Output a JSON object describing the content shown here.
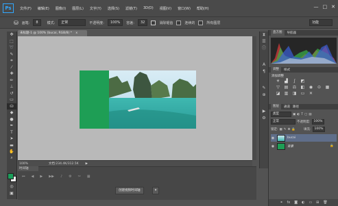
{
  "app": {
    "logo": "Ps"
  },
  "menu": [
    "文件(F)",
    "编辑(E)",
    "图像(I)",
    "图层(L)",
    "文字(Y)",
    "选择(S)",
    "滤镜(T)",
    "3D(D)",
    "视图(V)",
    "窗口(W)",
    "帮助(H)"
  ],
  "window_controls": [
    "—",
    "□",
    "✕"
  ],
  "options_bar": {
    "brush_label": "画笔:",
    "brush_size": "8",
    "mode_label": "模式:",
    "mode_value": "正常",
    "opacity_label": "不透明度:",
    "opacity_value": "100%",
    "flow_label": "容差:",
    "flow_value": "32",
    "antialias_label": "消除锯齿",
    "contiguous_label": "连续的",
    "all_layers_label": "所有图层",
    "workspace": "功能"
  },
  "document": {
    "tab_title": "未标题-1 @ 100% (bucai, RGB/8) *",
    "close_icon": "x",
    "zoom": "100%",
    "doc_info": "文档:234.4K/312.5K",
    "image_colors": {
      "green_panel": "#1e9e55"
    }
  },
  "timeline": {
    "tab_label": "时间轴",
    "create_button": "创建视频时间轴"
  },
  "right_panels": {
    "histogram_tabs": [
      "直方图",
      "导航器"
    ],
    "adjust_tabs": [
      "调整",
      "样式"
    ],
    "adjust_title": "添加调整",
    "layers_tabs": [
      "图层",
      "通道",
      "路径"
    ],
    "kind_label": "类型",
    "blend_mode": "正常",
    "opacity_label": "不透明度:",
    "opacity_value": "100%",
    "lock_label": "锁定:",
    "fill_label": "填充:",
    "fill_value": "100%",
    "layers": [
      {
        "name": "bucai",
        "thumb": "photo"
      },
      {
        "name": "背景",
        "thumb": "#1e9e55"
      }
    ]
  },
  "colors": {
    "foreground": "#1a9e5a",
    "background": "#f0f0f0",
    "accent": "#31a8ff"
  }
}
